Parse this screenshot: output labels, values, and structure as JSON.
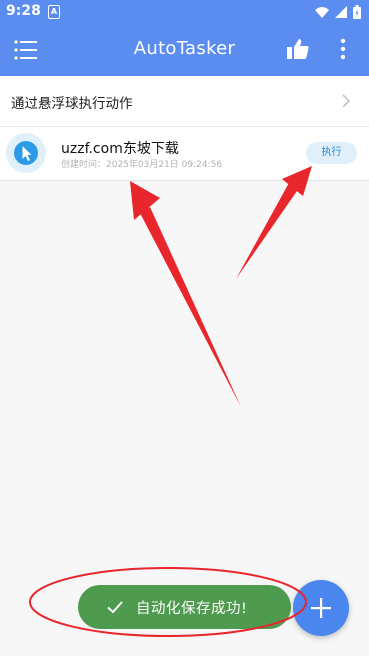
{
  "status_bar": {
    "time": "9:28",
    "notification_glyph": "A"
  },
  "app_bar": {
    "title": "AutoTasker",
    "menu_icon": "list-menu-icon",
    "like_icon": "thumbs-up-icon",
    "more_icon": "vertical-dots-icon",
    "background": "#5b8df0"
  },
  "floating_ball": {
    "label": "通过悬浮球执行动作"
  },
  "tasks": [
    {
      "name": "uzzf.com东坡下载",
      "created": "创建时间：2025年03月21日 09:24:56",
      "run_label": "执行",
      "icon": "cursor-pointer-icon"
    }
  ],
  "toast": {
    "message": "自动化保存成功!",
    "color": "#4e9a4e"
  },
  "fab": {
    "icon": "plus-icon",
    "color": "#4a86ee"
  },
  "annotations": {
    "arrow_color": "#e8262b"
  }
}
